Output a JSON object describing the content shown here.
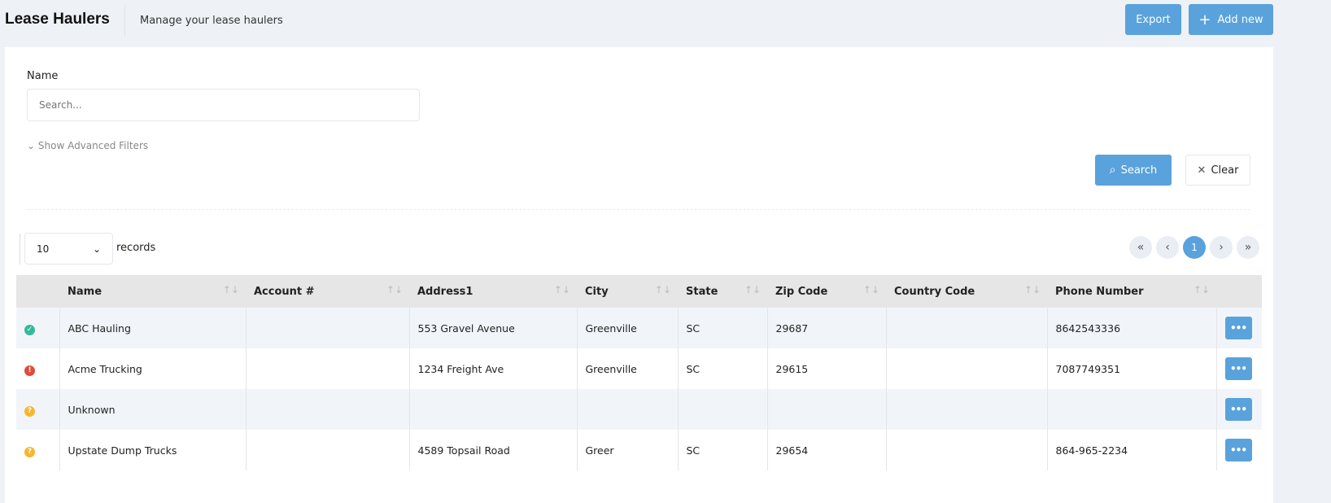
{
  "header": {
    "title": "Lease Haulers",
    "subtitle": "Manage your lease haulers",
    "export_label": "Export",
    "add_label": "Add new"
  },
  "filters": {
    "name_label": "Name",
    "name_placeholder": "Search...",
    "name_value": "",
    "advanced_label": "Show Advanced Filters",
    "search_label": "Search",
    "clear_label": "Clear"
  },
  "paging": {
    "page_size": "10",
    "records_label": "records",
    "current_page": "1"
  },
  "colors": {
    "accent": "#5aa2db",
    "ok": "#35b99a",
    "error": "#e04b3c",
    "unknown": "#f9b52c"
  },
  "table": {
    "columns": [
      "Name",
      "Account #",
      "Address1",
      "City",
      "State",
      "Zip Code",
      "Country Code",
      "Phone Number"
    ],
    "rows": [
      {
        "status": "ok",
        "name": "ABC Hauling",
        "account": "",
        "address": "553 Gravel Avenue",
        "city": "Greenville",
        "state": "SC",
        "zip": "29687",
        "country": "",
        "phone": "8642543336"
      },
      {
        "status": "error",
        "name": "Acme Trucking",
        "account": "",
        "address": "1234 Freight Ave",
        "city": "Greenville",
        "state": "SC",
        "zip": "29615",
        "country": "",
        "phone": "7087749351"
      },
      {
        "status": "unknown",
        "name": "Unknown",
        "account": "",
        "address": "",
        "city": "",
        "state": "",
        "zip": "",
        "country": "",
        "phone": ""
      },
      {
        "status": "unknown",
        "name": "Upstate Dump Trucks",
        "account": "",
        "address": "4589 Topsail Road",
        "city": "Greer",
        "state": "SC",
        "zip": "29654",
        "country": "",
        "phone": "864-965-2234"
      }
    ]
  }
}
